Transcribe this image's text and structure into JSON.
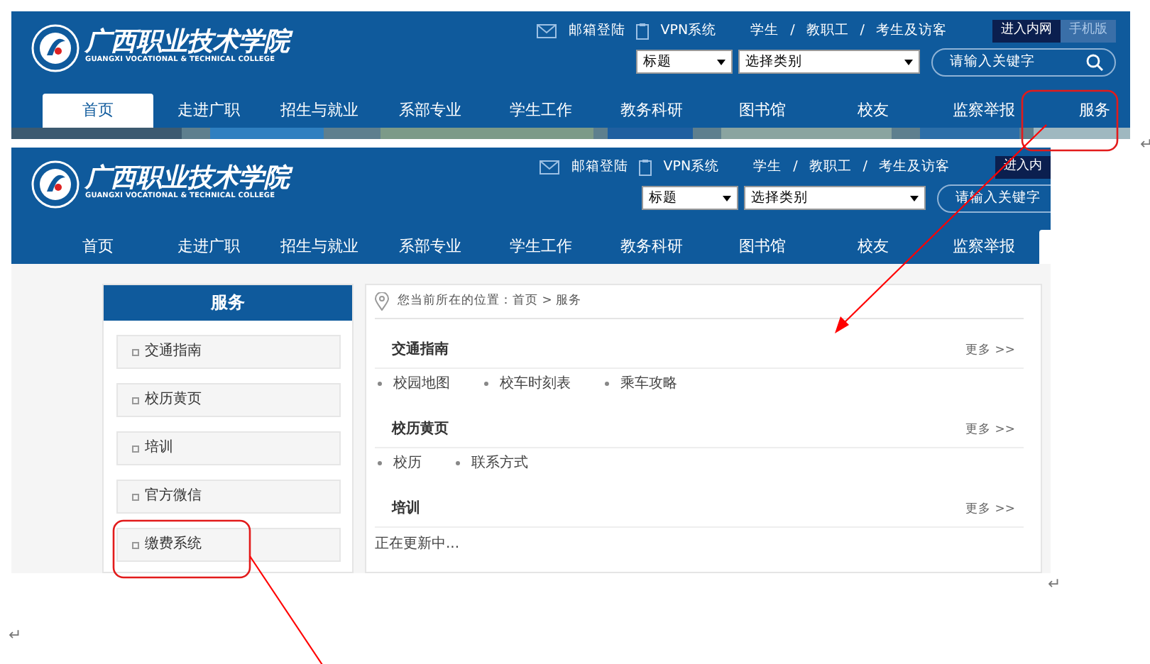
{
  "shots": [
    {
      "logo": {
        "name": "广西职业技术学院",
        "english": "GUANGXI VOCATIONAL & TECHNICAL COLLEGE"
      },
      "top_links": {
        "mail": "邮箱登陆",
        "vpn": "VPN系统",
        "audiences": [
          "学生",
          "教职工",
          "考生及访客"
        ],
        "separator": "/"
      },
      "buttons": [
        "进入内网",
        "手机版"
      ],
      "selects": [
        "标题",
        "选择类别"
      ],
      "search": {
        "placeholder": "请输入关键字",
        "icon": true
      },
      "nav": [
        {
          "label": "首页",
          "selected": true
        },
        {
          "label": "走进广职",
          "selected": false
        },
        {
          "label": "招生与就业",
          "selected": false
        },
        {
          "label": "系部专业",
          "selected": false
        },
        {
          "label": "学生工作",
          "selected": false
        },
        {
          "label": "教务科研",
          "selected": false
        },
        {
          "label": "图书馆",
          "selected": false
        },
        {
          "label": "校友",
          "selected": false
        },
        {
          "label": "监察举报",
          "selected": false
        },
        {
          "label": "服务",
          "selected": false
        }
      ],
      "photo_strip": {
        "kind": "picture"
      }
    },
    {
      "logo": {
        "name": "广西职业技术学院",
        "english": "GUANGXI VOCATIONAL & TECHNICAL COLLEGE"
      },
      "top_links": {
        "mail": "邮箱登陆",
        "vpn": "VPN系统",
        "audiences": [
          "学生",
          "教职工",
          "考生及访客"
        ],
        "separator": "/"
      },
      "buttons": [
        "进入内"
      ],
      "selects": [
        "标题",
        "选择类别"
      ],
      "search": {
        "placeholder": "请输入关键字"
      },
      "nav": [
        {
          "label": "首页",
          "selected": false
        },
        {
          "label": "走进广职",
          "selected": false
        },
        {
          "label": "招生与就业",
          "selected": false
        },
        {
          "label": "系部专业",
          "selected": false
        },
        {
          "label": "学生工作",
          "selected": false
        },
        {
          "label": "教务科研",
          "selected": false
        },
        {
          "label": "图书馆",
          "selected": false
        },
        {
          "label": "校友",
          "selected": false
        },
        {
          "label": "监察举报",
          "selected": false
        },
        {
          "selected": true
        }
      ],
      "sidebar": {
        "title": "服务",
        "items": [
          "交通指南",
          "校历黄页",
          "培训",
          "官方微信",
          "缴费系统"
        ]
      },
      "breadcrumb": {
        "prefix": "您当前所在的位置：",
        "items": [
          "首页",
          "服务"
        ],
        "separator": ">"
      },
      "sections": [
        {
          "title": "交通指南",
          "more": "更多 >>",
          "links": [
            "校园地图",
            "校车时刻表",
            "乘车攻略"
          ]
        },
        {
          "title": "校历黄页",
          "more": "更多 >>",
          "links": [
            "校历",
            "联系方式"
          ]
        },
        {
          "title": "培训",
          "more": "更多 >>",
          "note": "正在更新中..."
        }
      ]
    }
  ],
  "paragraph_marks": [
    "↵",
    "↵",
    "↵"
  ]
}
